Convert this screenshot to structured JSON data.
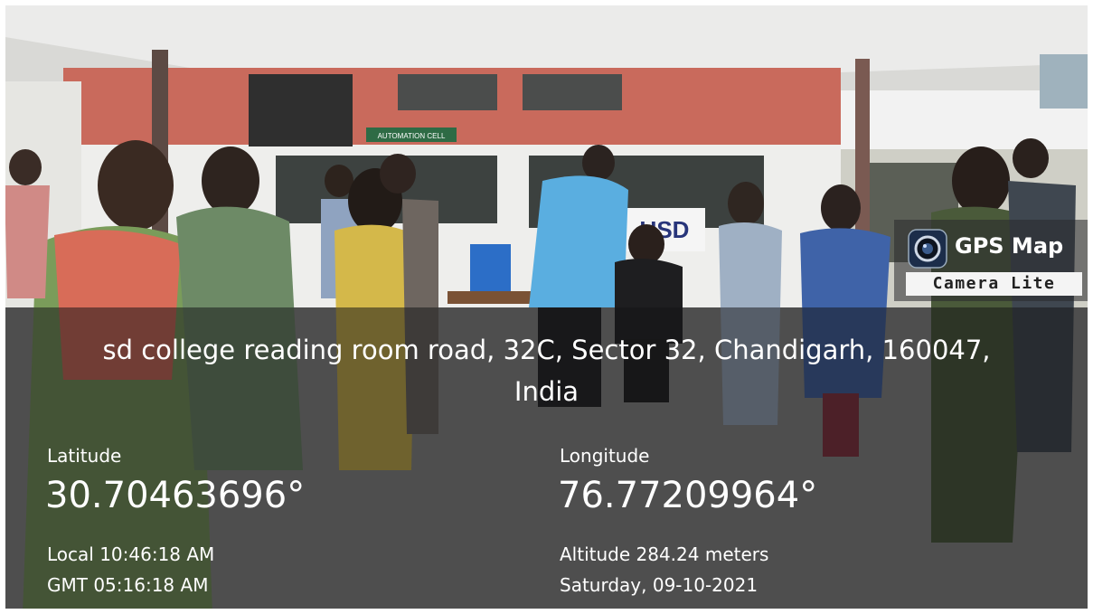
{
  "photo": {
    "sign_text": "AUTOMATION CELL",
    "banner_text": "USD"
  },
  "badge": {
    "title": "GPS Map",
    "subtitle": "Camera Lite",
    "icon": "camera-lens-icon"
  },
  "location": {
    "address_line1": "sd college reading room road, 32C, Sector 32, Chandigarh, 160047,",
    "address_line2": "India",
    "latitude_label": "Latitude",
    "latitude_value": "30.70463696°",
    "longitude_label": "Longitude",
    "longitude_value": "76.77209964°",
    "local_time": "Local 10:46:18 AM",
    "gmt_time": "GMT 05:16:18 AM",
    "altitude": "Altitude 284.24 meters",
    "date": "Saturday, 09-10-2021"
  },
  "colors": {
    "overlay": "#141416",
    "brick": "#c96a5c",
    "ceiling": "#e8e8e6",
    "floor": "#9a9a9a",
    "sign_green": "#2e6b45",
    "ppe_blue": "#5aaee0"
  }
}
